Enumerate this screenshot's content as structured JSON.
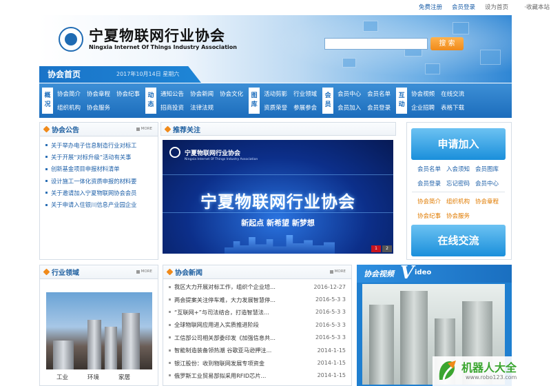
{
  "toplinks": {
    "register": "免费注册",
    "login": "会员登录",
    "homepage": "设为首页",
    "favorite": "·收藏本站"
  },
  "header": {
    "title": "宁夏物联网行业协会",
    "subtitle": "Ningxia Internet Of Things Industry Association",
    "search_placeholder": "",
    "search_button": "搜 索",
    "home_label": "协会首页",
    "date": "2017年10月14日 星期六"
  },
  "nav": [
    {
      "head": [
        "概",
        "况"
      ],
      "links": [
        "协会简介",
        "协会章程",
        "协会纪事",
        "组织机构",
        "协会服务"
      ]
    },
    {
      "head": [
        "动",
        "态"
      ],
      "links": [
        "通知公告",
        "协会新闻",
        "协会文化",
        "招商投资",
        "法律法规"
      ]
    },
    {
      "head": [
        "图",
        "库"
      ],
      "links": [
        "活动剪影",
        "行业领域",
        "",
        "资质荣誉",
        "参展参会"
      ]
    },
    {
      "head": [
        "会",
        "员"
      ],
      "links": [
        "会员中心",
        "会员名单",
        "",
        "会员加入",
        "会员登录"
      ]
    },
    {
      "head": [
        "互",
        "动"
      ],
      "links": [
        "协会视频",
        "在线交流",
        "",
        "企业招聘",
        "表格下载"
      ]
    }
  ],
  "notices": {
    "title": "协会公告",
    "more": "MORE",
    "items": [
      "关于举办电子信息制造行业对标工",
      "关于开展“对标升级”活动有关事",
      "创新基金项目申报材料清单",
      "设计施工一体化资质申报的材料要",
      "关于邀请加入宁夏物联网协会会员",
      "关于申请入住银川信息产业园企业"
    ]
  },
  "recommend": {
    "title": "推荐关注",
    "banner": {
      "top": "宁夏物联网行业协会",
      "top_sub": "Ningxia Internet Of Things Industry Association",
      "main": "宁夏物联网行业协会",
      "slogan": "新起点 新希望 新梦想",
      "pages": [
        "1",
        "2"
      ]
    }
  },
  "sidebar": {
    "join_label": "申请加入",
    "links1": [
      "会员名单",
      "入会须知",
      "会员图库",
      "会员登录",
      "忘记密码",
      "会员中心"
    ],
    "links2": [
      "协会简介",
      "组织机构",
      "协会章程",
      "协会纪事",
      "协会服务"
    ],
    "chat_label": "在线交流"
  },
  "industry": {
    "title": "行业领域",
    "more": "MORE",
    "labels": [
      "工业",
      "环境",
      "家居"
    ]
  },
  "news": {
    "title": "协会新闻",
    "more": "MORE",
    "rows": [
      {
        "title": "我区大力开展对标工作，组织个企业培...",
        "date": "2016-12-27"
      },
      {
        "title": "两会提案关注停车难，大力发展智慧停...",
        "date": "2016-5-3 3"
      },
      {
        "title": "“互联网+”与司法结合，打造智慧法...",
        "date": "2016-5-3 3"
      },
      {
        "title": "全球物联网应用进入实质推进阶段",
        "date": "2016-5-3 3"
      },
      {
        "title": "工信部公司相关部委印发《加强信息共...",
        "date": "2016-5-3 3"
      },
      {
        "title": "智能制造装备领热潮 谷歌亚马逊押注...",
        "date": "2014-1-15"
      },
      {
        "title": "银江股份：收到物联网发展专项资金",
        "date": "2014-1-15"
      },
      {
        "title": "俄罗斯工业贸易部拟采用RFID芯片...",
        "date": "2014-1-15"
      }
    ]
  },
  "video": {
    "title": "协会视频",
    "v": "V",
    "ideo": "ideo"
  },
  "watermark": {
    "title": "机器人大全",
    "url": "www.robo123.com"
  },
  "colors": {
    "primary": "#1c6dbc",
    "accent": "#f08a1a",
    "link": "#1c5fa8"
  }
}
